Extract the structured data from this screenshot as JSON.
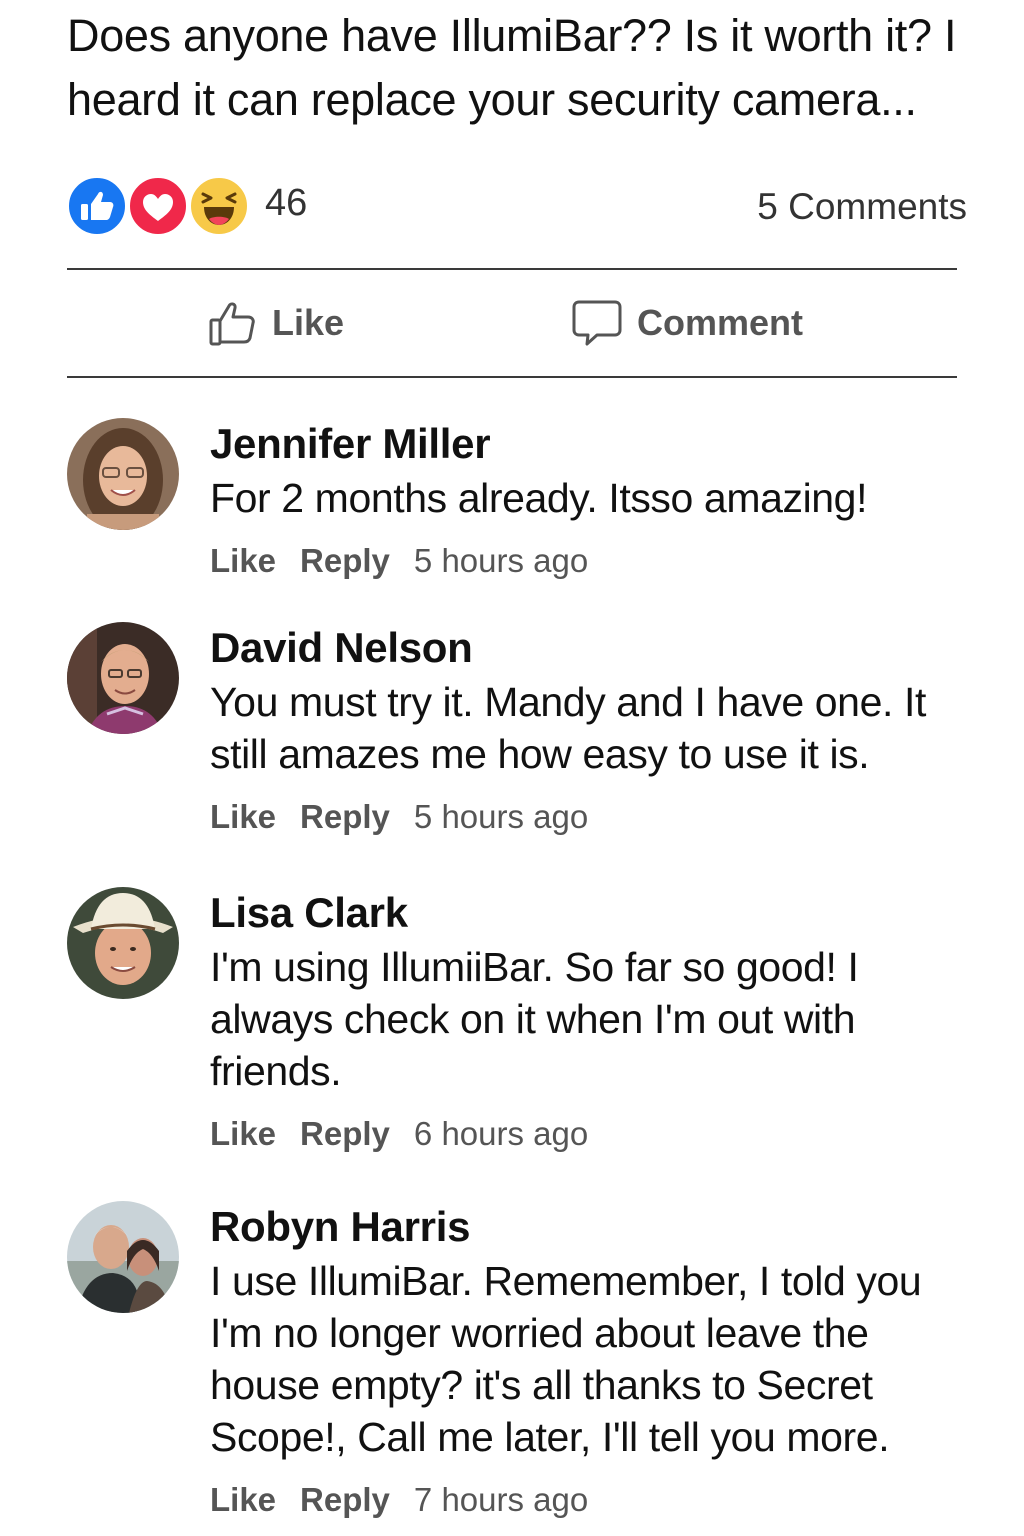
{
  "post": {
    "text": "Does anyone have IllumiBar?? Is it worth it? I heard it can replace your security camera..."
  },
  "reactions": {
    "icons": [
      "like-icon",
      "love-icon",
      "haha-icon"
    ],
    "count": "46",
    "comments_count": "5 Comments",
    "colors": {
      "like": "#1877f2",
      "love": "#f0284a",
      "haha": "#f7c948"
    }
  },
  "actions": {
    "like_label": "Like",
    "comment_label": "Comment"
  },
  "comments": [
    {
      "name": "Jennifer Miller",
      "text": "For 2 months already. Itsso amazing!",
      "like": "Like",
      "reply": "Reply",
      "time": "5 hours ago"
    },
    {
      "name": "David Nelson",
      "text": "You must try it. Mandy and I have one. It still amazes me how easy to use it is.",
      "like": "Like",
      "reply": "Reply",
      "time": "5 hours ago"
    },
    {
      "name": "Lisa Clark",
      "text": "I'm using IllumiiBar. So far so good! I always check on it when I'm out with friends.",
      "like": "Like",
      "reply": "Reply",
      "time": "6 hours ago"
    },
    {
      "name": "Robyn Harris",
      "text": "I use IllumiBar. Rememember, I told you I'm no longer worried about leave the house empty? it's all thanks to Secret Scope!, Call me later, I'll tell you more.",
      "like": "Like",
      "reply": "Reply",
      "time": "7 hours ago"
    }
  ]
}
